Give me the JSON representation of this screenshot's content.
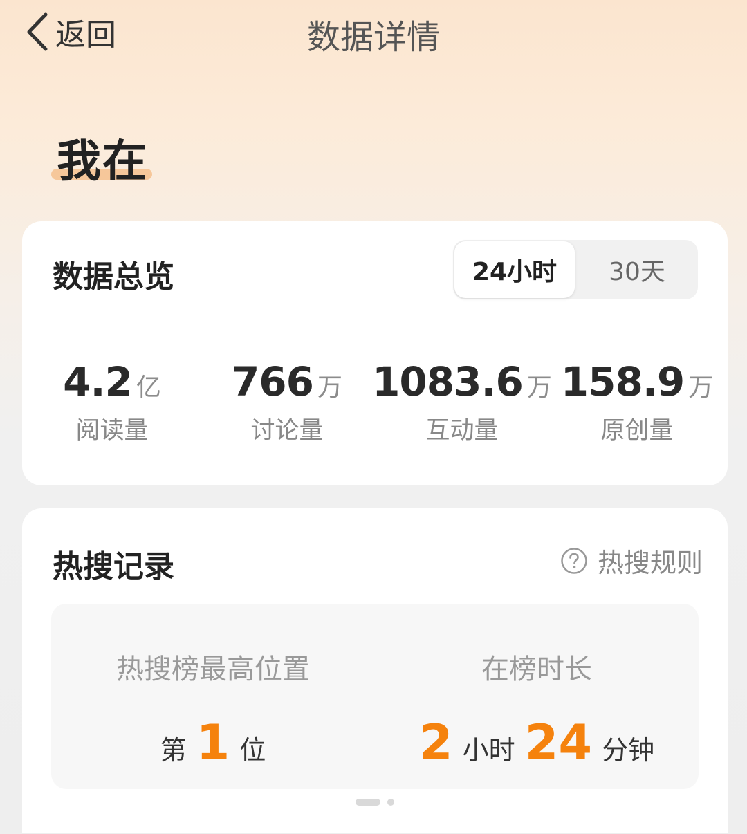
{
  "header": {
    "back_label": "返回",
    "title": "数据详情"
  },
  "topic": {
    "name": "我在"
  },
  "overview": {
    "title": "数据总览",
    "tabs": [
      {
        "label": "24小时",
        "selected": true
      },
      {
        "label": "30天",
        "selected": false
      }
    ],
    "stats": [
      {
        "value": "4.2",
        "unit": "亿",
        "label": "阅读量"
      },
      {
        "value": "766",
        "unit": "万",
        "label": "讨论量"
      },
      {
        "value": "1083.6",
        "unit": "万",
        "label": "互动量"
      },
      {
        "value": "158.9",
        "unit": "万",
        "label": "原创量"
      }
    ]
  },
  "hot_search": {
    "title": "热搜记录",
    "rules_label": "热搜规则",
    "rules_icon": "question-circle-icon",
    "highest_position": {
      "title": "热搜榜最高位置",
      "prefix": "第",
      "value": "1",
      "suffix": "位"
    },
    "duration": {
      "title": "在榜时长",
      "hours": "2",
      "hours_unit": "小时",
      "minutes": "24",
      "minutes_unit": "分钟"
    },
    "pager": {
      "pages": 2,
      "current": 1
    }
  },
  "colors": {
    "accent": "#f5820d",
    "topic_underline": "#f6c79a",
    "card_bg": "#ffffff",
    "page_bg": "#eeeeee"
  }
}
